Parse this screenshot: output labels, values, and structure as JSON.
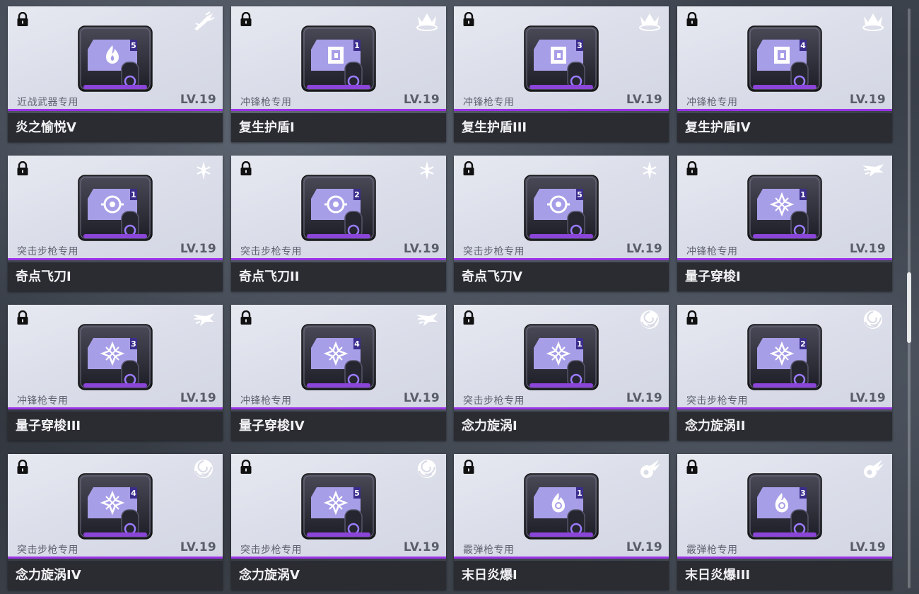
{
  "colors": {
    "accent": "#9a33e6",
    "name_bar": "#2a2c31",
    "card_bg": "#dcdfea"
  },
  "cards": [
    {
      "name": "炎之愉悦V",
      "category": "近战武器专用",
      "level": "LV.19",
      "slot": "5",
      "emblem": "flame-icon",
      "weapon_icon": "blade-weapon-icon"
    },
    {
      "name": "复生护盾I",
      "category": "冲锋枪专用",
      "level": "LV.19",
      "slot": "1",
      "emblem": "shield-square-icon",
      "weapon_icon": "crown-weapon-icon"
    },
    {
      "name": "复生护盾III",
      "category": "冲锋枪专用",
      "level": "LV.19",
      "slot": "3",
      "emblem": "shield-square-icon",
      "weapon_icon": "crown-weapon-icon"
    },
    {
      "name": "复生护盾IV",
      "category": "冲锋枪专用",
      "level": "LV.19",
      "slot": "4",
      "emblem": "shield-square-icon",
      "weapon_icon": "crown-weapon-icon"
    },
    {
      "name": "奇点飞刀I",
      "category": "突击步枪专用",
      "level": "LV.19",
      "slot": "1",
      "emblem": "target-icon",
      "weapon_icon": "dagger-weapon-icon"
    },
    {
      "name": "奇点飞刀II",
      "category": "突击步枪专用",
      "level": "LV.19",
      "slot": "2",
      "emblem": "target-icon",
      "weapon_icon": "dagger-weapon-icon"
    },
    {
      "name": "奇点飞刀V",
      "category": "突击步枪专用",
      "level": "LV.19",
      "slot": "5",
      "emblem": "target-icon",
      "weapon_icon": "dagger-weapon-icon"
    },
    {
      "name": "量子穿梭I",
      "category": "冲锋枪专用",
      "level": "LV.19",
      "slot": "1",
      "emblem": "shuriken-icon",
      "weapon_icon": "wing-weapon-icon"
    },
    {
      "name": "量子穿梭III",
      "category": "冲锋枪专用",
      "level": "LV.19",
      "slot": "3",
      "emblem": "shuriken-icon",
      "weapon_icon": "wing-weapon-icon"
    },
    {
      "name": "量子穿梭IV",
      "category": "冲锋枪专用",
      "level": "LV.19",
      "slot": "4",
      "emblem": "shuriken-icon",
      "weapon_icon": "wing-weapon-icon"
    },
    {
      "name": "念力旋涡I",
      "category": "突击步枪专用",
      "level": "LV.19",
      "slot": "1",
      "emblem": "shuriken-icon",
      "weapon_icon": "vortex-weapon-icon"
    },
    {
      "name": "念力旋涡II",
      "category": "突击步枪专用",
      "level": "LV.19",
      "slot": "2",
      "emblem": "shuriken-icon",
      "weapon_icon": "vortex-weapon-icon"
    },
    {
      "name": "念力旋涡IV",
      "category": "突击步枪专用",
      "level": "LV.19",
      "slot": "4",
      "emblem": "shuriken-icon",
      "weapon_icon": "vortex-weapon-icon"
    },
    {
      "name": "念力旋涡V",
      "category": "突击步枪专用",
      "level": "LV.19",
      "slot": "5",
      "emblem": "shuriken-icon",
      "weapon_icon": "vortex-weapon-icon"
    },
    {
      "name": "末日炎爆I",
      "category": "霰弹枪专用",
      "level": "LV.19",
      "slot": "1",
      "emblem": "flame-swirl-icon",
      "weapon_icon": "fireball-weapon-icon"
    },
    {
      "name": "末日炎爆III",
      "category": "霰弹枪专用",
      "level": "LV.19",
      "slot": "3",
      "emblem": "flame-swirl-icon",
      "weapon_icon": "fireball-weapon-icon"
    }
  ]
}
